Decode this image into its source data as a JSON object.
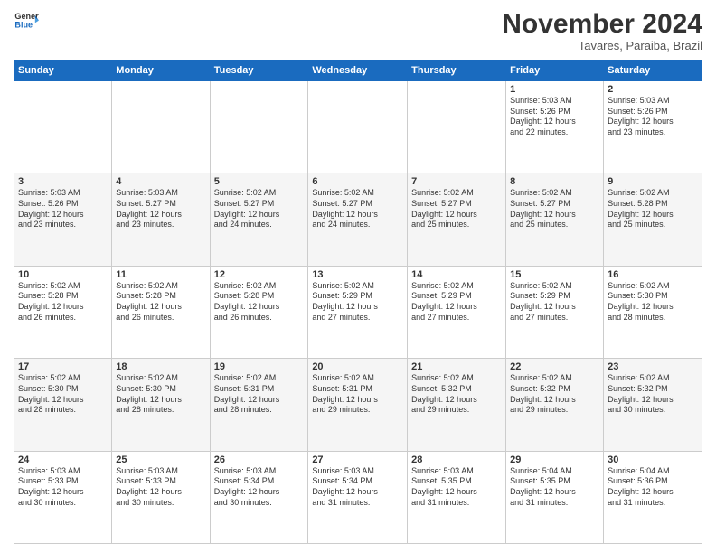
{
  "logo": {
    "line1": "General",
    "line2": "Blue"
  },
  "title": "November 2024",
  "subtitle": "Tavares, Paraiba, Brazil",
  "days_of_week": [
    "Sunday",
    "Monday",
    "Tuesday",
    "Wednesday",
    "Thursday",
    "Friday",
    "Saturday"
  ],
  "weeks": [
    [
      {
        "day": "",
        "info": ""
      },
      {
        "day": "",
        "info": ""
      },
      {
        "day": "",
        "info": ""
      },
      {
        "day": "",
        "info": ""
      },
      {
        "day": "",
        "info": ""
      },
      {
        "day": "1",
        "info": "Sunrise: 5:03 AM\nSunset: 5:26 PM\nDaylight: 12 hours\nand 22 minutes."
      },
      {
        "day": "2",
        "info": "Sunrise: 5:03 AM\nSunset: 5:26 PM\nDaylight: 12 hours\nand 23 minutes."
      }
    ],
    [
      {
        "day": "3",
        "info": "Sunrise: 5:03 AM\nSunset: 5:26 PM\nDaylight: 12 hours\nand 23 minutes."
      },
      {
        "day": "4",
        "info": "Sunrise: 5:03 AM\nSunset: 5:27 PM\nDaylight: 12 hours\nand 23 minutes."
      },
      {
        "day": "5",
        "info": "Sunrise: 5:02 AM\nSunset: 5:27 PM\nDaylight: 12 hours\nand 24 minutes."
      },
      {
        "day": "6",
        "info": "Sunrise: 5:02 AM\nSunset: 5:27 PM\nDaylight: 12 hours\nand 24 minutes."
      },
      {
        "day": "7",
        "info": "Sunrise: 5:02 AM\nSunset: 5:27 PM\nDaylight: 12 hours\nand 25 minutes."
      },
      {
        "day": "8",
        "info": "Sunrise: 5:02 AM\nSunset: 5:27 PM\nDaylight: 12 hours\nand 25 minutes."
      },
      {
        "day": "9",
        "info": "Sunrise: 5:02 AM\nSunset: 5:28 PM\nDaylight: 12 hours\nand 25 minutes."
      }
    ],
    [
      {
        "day": "10",
        "info": "Sunrise: 5:02 AM\nSunset: 5:28 PM\nDaylight: 12 hours\nand 26 minutes."
      },
      {
        "day": "11",
        "info": "Sunrise: 5:02 AM\nSunset: 5:28 PM\nDaylight: 12 hours\nand 26 minutes."
      },
      {
        "day": "12",
        "info": "Sunrise: 5:02 AM\nSunset: 5:28 PM\nDaylight: 12 hours\nand 26 minutes."
      },
      {
        "day": "13",
        "info": "Sunrise: 5:02 AM\nSunset: 5:29 PM\nDaylight: 12 hours\nand 27 minutes."
      },
      {
        "day": "14",
        "info": "Sunrise: 5:02 AM\nSunset: 5:29 PM\nDaylight: 12 hours\nand 27 minutes."
      },
      {
        "day": "15",
        "info": "Sunrise: 5:02 AM\nSunset: 5:29 PM\nDaylight: 12 hours\nand 27 minutes."
      },
      {
        "day": "16",
        "info": "Sunrise: 5:02 AM\nSunset: 5:30 PM\nDaylight: 12 hours\nand 28 minutes."
      }
    ],
    [
      {
        "day": "17",
        "info": "Sunrise: 5:02 AM\nSunset: 5:30 PM\nDaylight: 12 hours\nand 28 minutes."
      },
      {
        "day": "18",
        "info": "Sunrise: 5:02 AM\nSunset: 5:30 PM\nDaylight: 12 hours\nand 28 minutes."
      },
      {
        "day": "19",
        "info": "Sunrise: 5:02 AM\nSunset: 5:31 PM\nDaylight: 12 hours\nand 28 minutes."
      },
      {
        "day": "20",
        "info": "Sunrise: 5:02 AM\nSunset: 5:31 PM\nDaylight: 12 hours\nand 29 minutes."
      },
      {
        "day": "21",
        "info": "Sunrise: 5:02 AM\nSunset: 5:32 PM\nDaylight: 12 hours\nand 29 minutes."
      },
      {
        "day": "22",
        "info": "Sunrise: 5:02 AM\nSunset: 5:32 PM\nDaylight: 12 hours\nand 29 minutes."
      },
      {
        "day": "23",
        "info": "Sunrise: 5:02 AM\nSunset: 5:32 PM\nDaylight: 12 hours\nand 30 minutes."
      }
    ],
    [
      {
        "day": "24",
        "info": "Sunrise: 5:03 AM\nSunset: 5:33 PM\nDaylight: 12 hours\nand 30 minutes."
      },
      {
        "day": "25",
        "info": "Sunrise: 5:03 AM\nSunset: 5:33 PM\nDaylight: 12 hours\nand 30 minutes."
      },
      {
        "day": "26",
        "info": "Sunrise: 5:03 AM\nSunset: 5:34 PM\nDaylight: 12 hours\nand 30 minutes."
      },
      {
        "day": "27",
        "info": "Sunrise: 5:03 AM\nSunset: 5:34 PM\nDaylight: 12 hours\nand 31 minutes."
      },
      {
        "day": "28",
        "info": "Sunrise: 5:03 AM\nSunset: 5:35 PM\nDaylight: 12 hours\nand 31 minutes."
      },
      {
        "day": "29",
        "info": "Sunrise: 5:04 AM\nSunset: 5:35 PM\nDaylight: 12 hours\nand 31 minutes."
      },
      {
        "day": "30",
        "info": "Sunrise: 5:04 AM\nSunset: 5:36 PM\nDaylight: 12 hours\nand 31 minutes."
      }
    ]
  ]
}
